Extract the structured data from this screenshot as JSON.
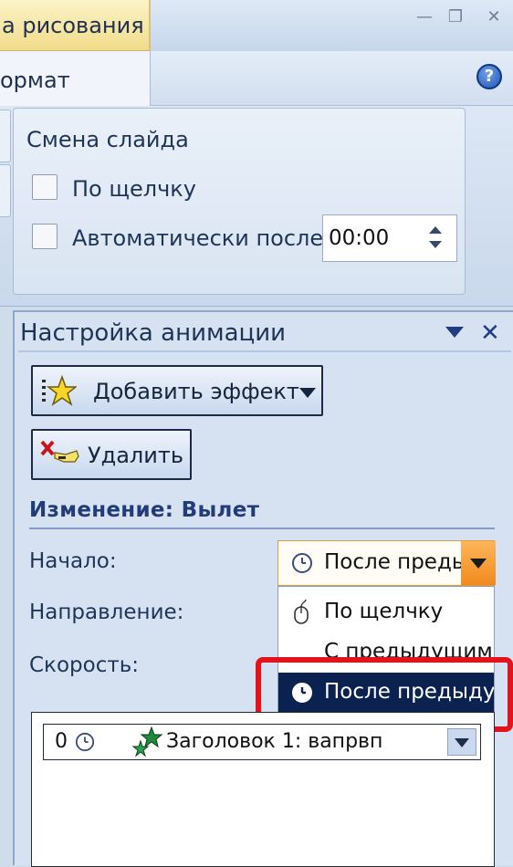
{
  "window": {
    "context_tab_label": "а рисования",
    "minimize_glyph": "—",
    "restore_glyph": "❐",
    "close_glyph": "✕"
  },
  "ribbon": {
    "format_tab_label": "ормат",
    "help_glyph": "?",
    "transition_group": {
      "title": "Смена слайда",
      "on_click_label": "По щелчку",
      "on_click_checked": false,
      "auto_after_label": "Автоматически после:",
      "auto_after_checked": false,
      "time_value": "00:00"
    }
  },
  "animation_pane": {
    "title": "Настройка анимации",
    "close_glyph": "✕",
    "add_effect_label": "Добавить эффект",
    "delete_label": "Удалить",
    "change_heading": "Изменение: Вылет",
    "start_label": "Начало:",
    "direction_label": "Направление:",
    "speed_label": "Скорость:",
    "start_select_value": "После преды",
    "start_menu": {
      "items": [
        {
          "label": "По щелчку",
          "icon": "mouse-click-icon"
        },
        {
          "label": "С предыдущим",
          "icon": "none"
        },
        {
          "label": "После предыду",
          "icon": "clock-icon",
          "selected": true
        }
      ]
    },
    "anim_list": {
      "items": [
        {
          "order": "0",
          "label": "Заголовок 1: вапрвп",
          "icon": "clock-icon"
        }
      ]
    }
  },
  "colors": {
    "accent_orange": "#f08a1e",
    "selected_bg": "#0b2150",
    "highlight_red": "#e3131b"
  }
}
